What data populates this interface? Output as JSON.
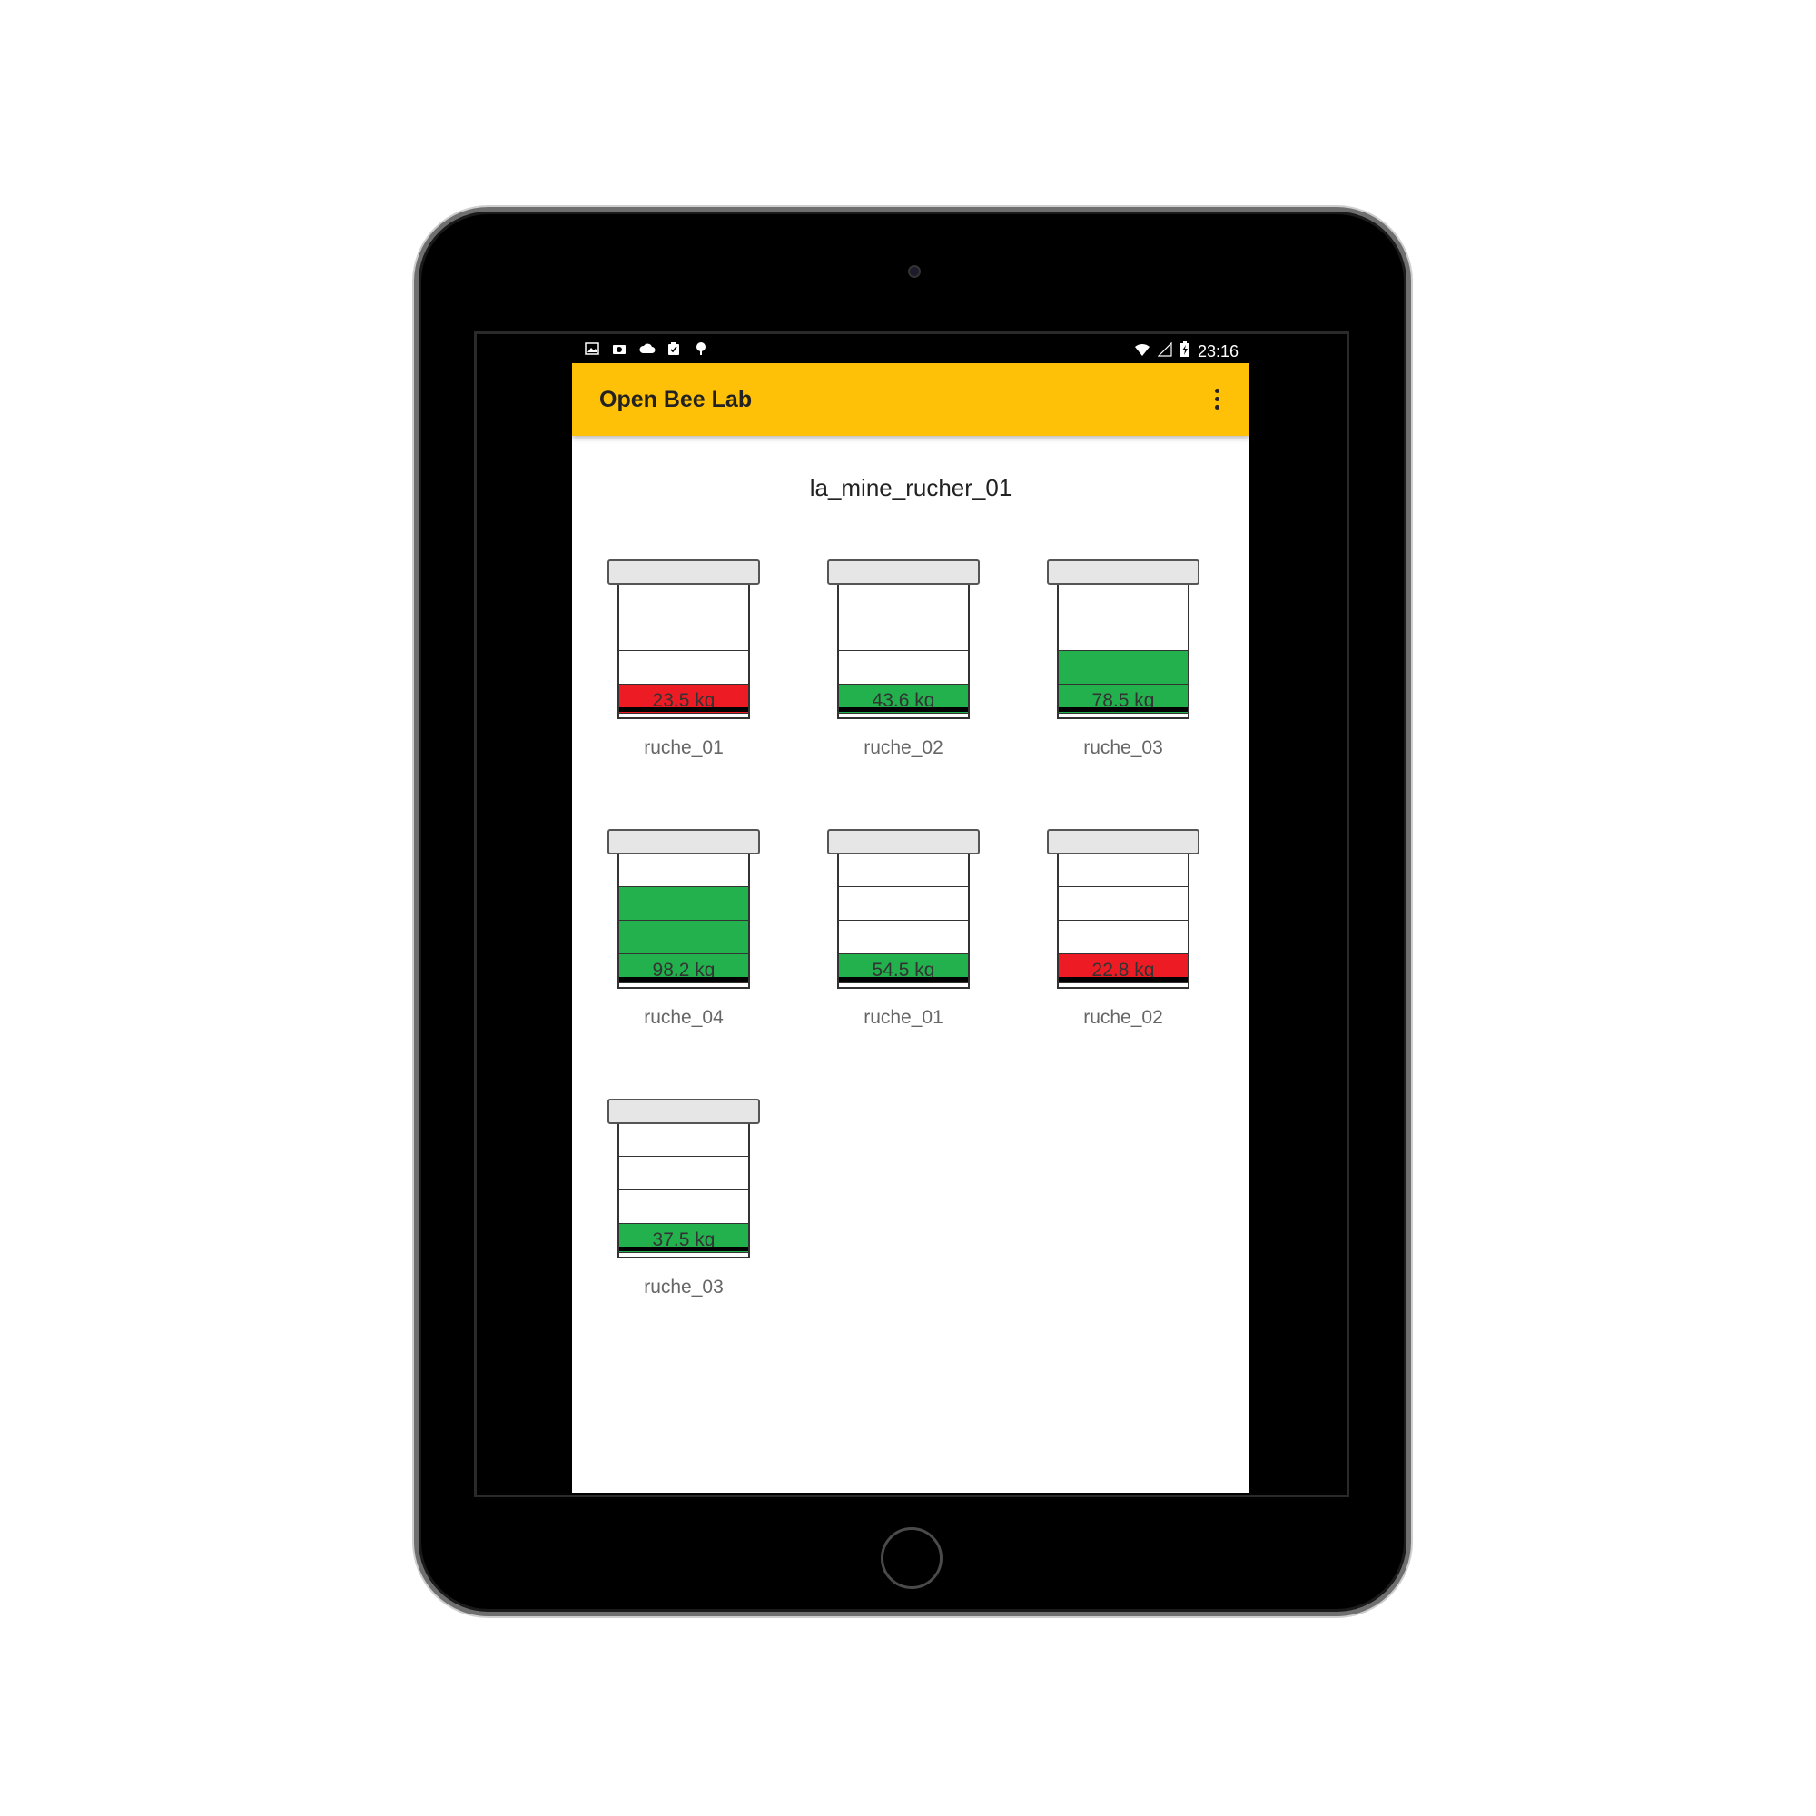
{
  "status_bar": {
    "left_icons": [
      "image-icon",
      "camera-icon",
      "cloud-icon",
      "clipboard-check-icon",
      "tree-icon"
    ],
    "right_icons": [
      "wifi-icon",
      "signal-icon",
      "battery-charging-icon"
    ],
    "time": "23:16"
  },
  "app_bar": {
    "title": "Open Bee Lab",
    "menu_icon": "overflow-menu-icon"
  },
  "apiary": {
    "name": "la_mine_rucher_01"
  },
  "colors": {
    "app_bar": "#FFC107",
    "weight_low": "#ED1C24",
    "weight_ok": "#22B14C"
  },
  "hives": [
    {
      "name": "ruche_01",
      "weight": "23.5 kg",
      "status": "low",
      "filled_boxes": 1
    },
    {
      "name": "ruche_02",
      "weight": "43.6 kg",
      "status": "ok",
      "filled_boxes": 1
    },
    {
      "name": "ruche_03",
      "weight": "78.5 kg",
      "status": "ok",
      "filled_boxes": 2
    },
    {
      "name": "ruche_04",
      "weight": "98.2 kg",
      "status": "ok",
      "filled_boxes": 3
    },
    {
      "name": "ruche_01",
      "weight": "54.5 kg",
      "status": "ok",
      "filled_boxes": 1
    },
    {
      "name": "ruche_02",
      "weight": "22.8 kg",
      "status": "low",
      "filled_boxes": 1
    },
    {
      "name": "ruche_03",
      "weight": "37.5 kg",
      "status": "ok",
      "filled_boxes": 1
    }
  ]
}
